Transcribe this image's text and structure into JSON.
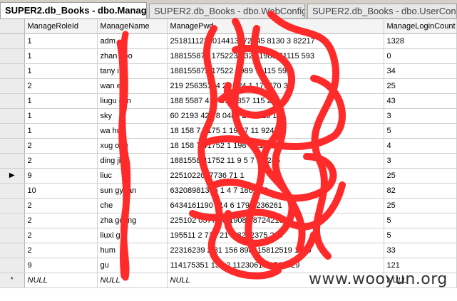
{
  "tabs": [
    {
      "label": "SUPER2.db_Books - dbo.Manage",
      "active": true
    },
    {
      "label": "SUPER2.db_Books - dbo.WebConfig",
      "active": false
    },
    {
      "label": "SUPER2.db_Books - dbo.UserConfig",
      "active": false
    }
  ],
  "columns": [
    "ManageRoleId",
    "ManageName",
    "ManagePwd",
    "ManageLoginCount"
  ],
  "rows": [
    {
      "marker": "",
      "role": "1",
      "name": "adm",
      "pwd": "2518111233014413572245 8130 3 82217",
      "count": "1328"
    },
    {
      "marker": "",
      "role": "1",
      "name": "zhan obo",
      "pwd": "188155872 1752234 32 11989 71115 593",
      "count": "0"
    },
    {
      "marker": "",
      "role": "1",
      "name": "tany ing",
      "pwd": "188155872 17522 1989 71115 593",
      "count": "34"
    },
    {
      "marker": "",
      "role": "2",
      "name": "wan e",
      "pwd": "219 25635194 27 124 1 171470 37",
      "count": "25"
    },
    {
      "marker": "",
      "role": "1",
      "name": "liugu glin",
      "pwd": "188 5587 417 5119857 115 245",
      "count": "43"
    },
    {
      "marker": "",
      "role": "1",
      "name": "sky",
      "pwd": "60 2193 420 8 0480 2437 13 1",
      "count": "3"
    },
    {
      "marker": "",
      "role": "1",
      "name": "wa huo",
      "pwd": "18 158 7 4175 1 198 7 11 9245",
      "count": "5"
    },
    {
      "marker": "",
      "role": "2",
      "name": "xug ong",
      "pwd": "18 158 7 41752 1 198 7 115 5",
      "count": "4"
    },
    {
      "marker": "",
      "role": "2",
      "name": "ding jiao",
      "pwd": "1881558 41752 11 9 5 7 11 245",
      "count": "3"
    },
    {
      "marker": "▶",
      "role": "9",
      "name": "liuc",
      "pwd": "2251022057736 71 1",
      "count": "25"
    },
    {
      "marker": "",
      "role": "10",
      "name": "sun gyuan",
      "pwd": "63208981376 1 4 7 1862 12",
      "count": "82"
    },
    {
      "marker": "",
      "role": "2",
      "name": "che",
      "pwd": "6434161190 114 6 179 3236261",
      "count": "25"
    },
    {
      "marker": "",
      "role": "2",
      "name": "zha gcong",
      "pwd": "225102 05773 6 1908 48724215 2",
      "count": "5"
    },
    {
      "marker": "",
      "role": "2",
      "name": "liuxi g",
      "pwd": "195511 2 718 21 1 8292375 289",
      "count": "5"
    },
    {
      "marker": "",
      "role": "2",
      "name": "hum",
      "pwd": "22316239 2 31 156 898415812519 1175",
      "count": "33"
    },
    {
      "marker": "",
      "role": "9",
      "name": "gu",
      "pwd": "114175351 130 2 11230613 1565329",
      "count": "121"
    },
    {
      "marker": "*",
      "role": "NULL",
      "name": "NULL",
      "pwd": "NULL",
      "count": "NULL"
    }
  ],
  "watermark": "www.wooyun.org",
  "colors": {
    "scribble": "#ff2a2a",
    "tabbar": "#d4d0c8"
  }
}
